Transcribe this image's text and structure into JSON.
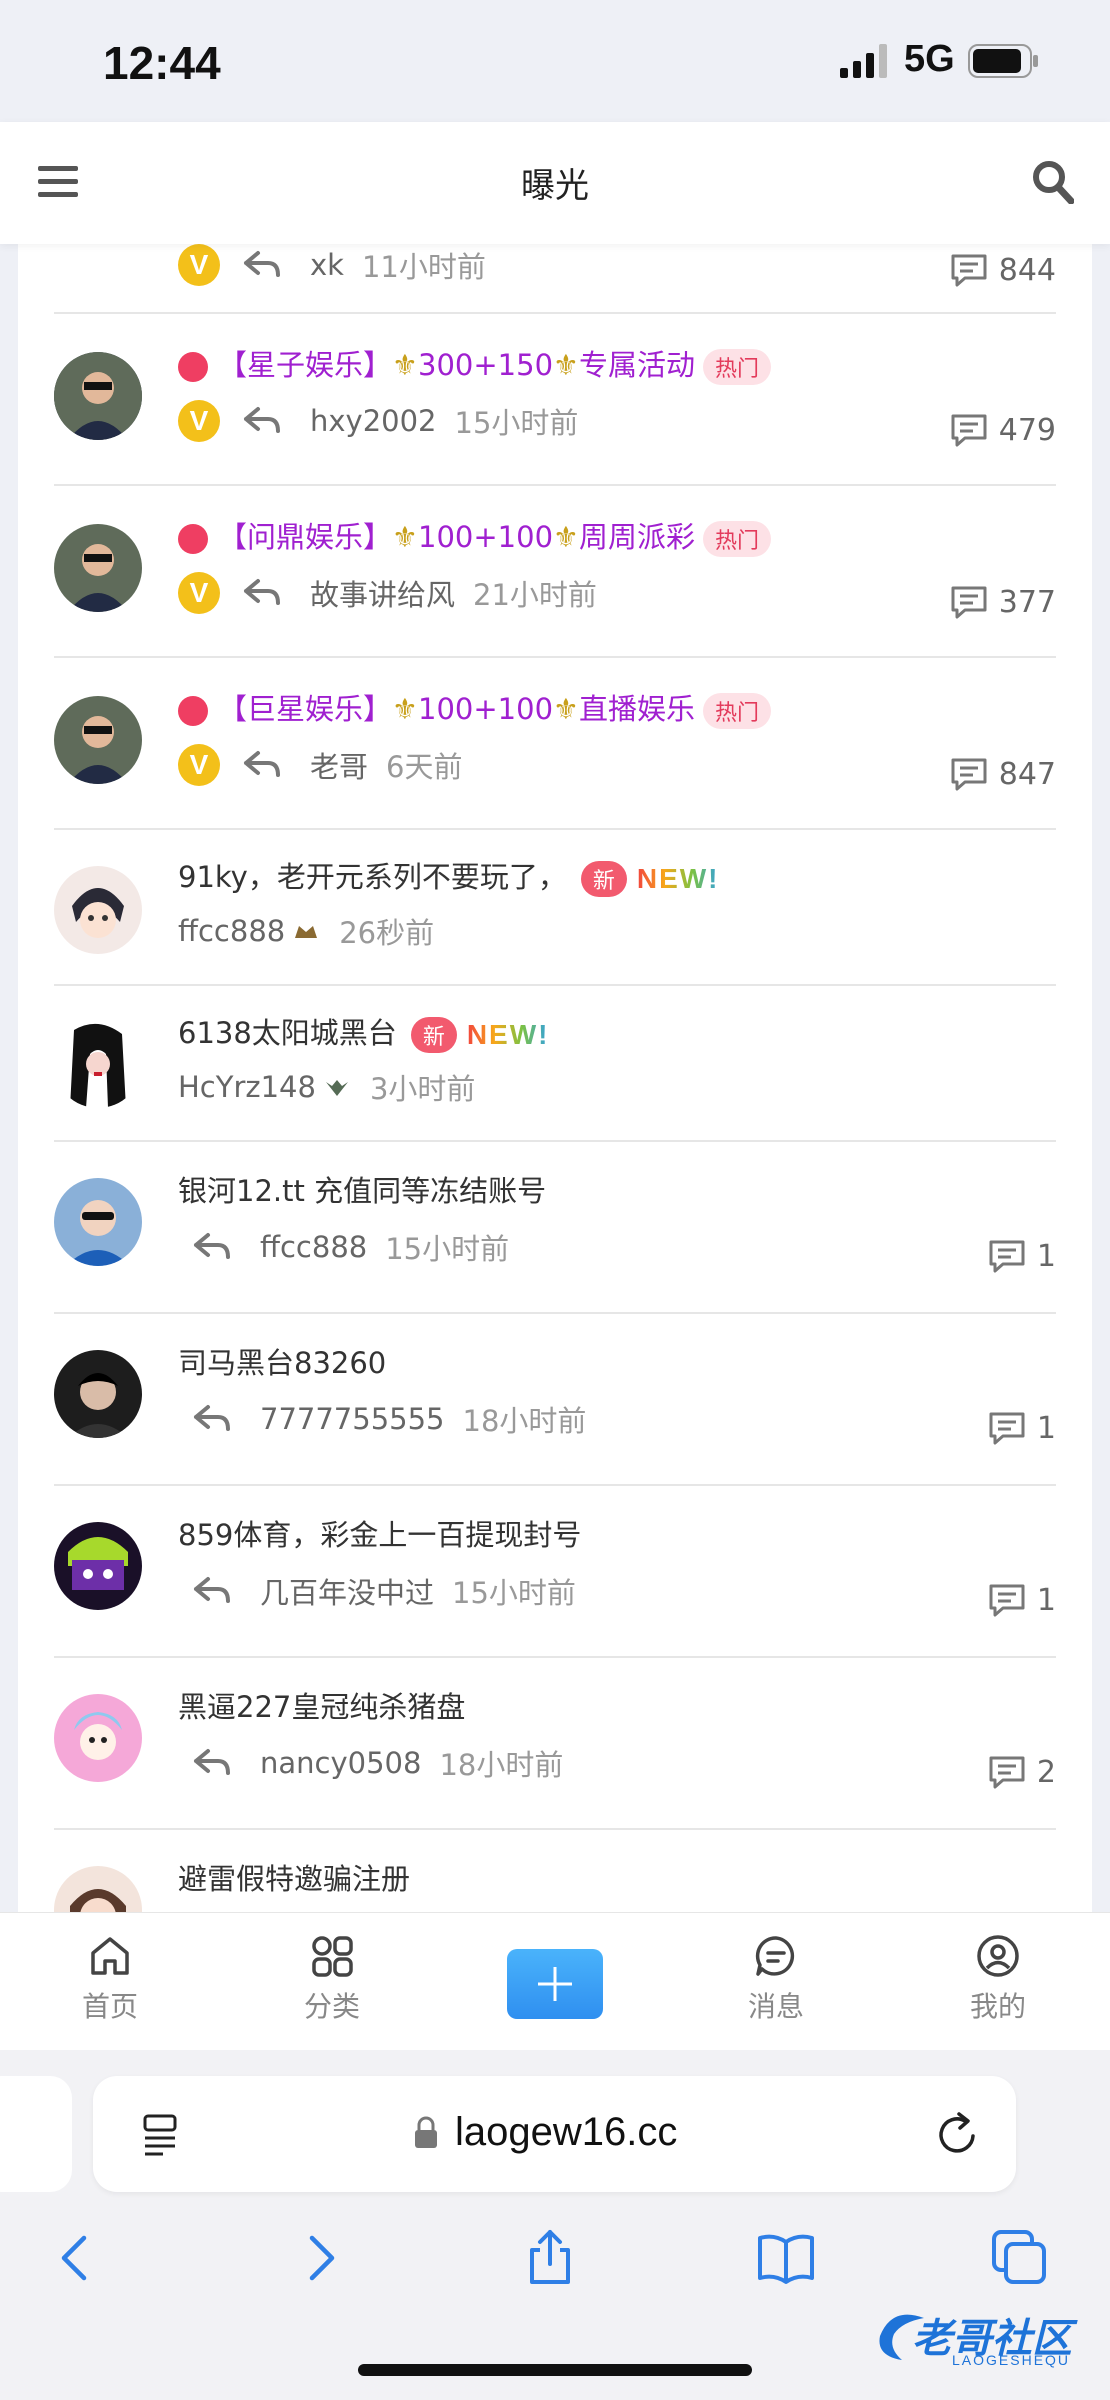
{
  "status_bar": {
    "time": "12:44",
    "network": "5G"
  },
  "header": {
    "title": "曝光"
  },
  "posts": [
    {
      "kind": "pinned",
      "user": "xk",
      "time": "11小时前",
      "comments": "844"
    },
    {
      "kind": "pinned",
      "title": "【星子娱乐】",
      "title_b": "300+150",
      "title_c": "专属活动",
      "badge": "热门",
      "user": "hxy2002",
      "time": "15小时前",
      "comments": "479"
    },
    {
      "kind": "pinned",
      "title": "【问鼎娱乐】",
      "title_b": "100+100",
      "title_c": "周周派彩",
      "badge": "热门",
      "user": "故事讲给风",
      "time": "21小时前",
      "comments": "377"
    },
    {
      "kind": "pinned",
      "title": "【巨星娱乐】",
      "title_b": "100+100",
      "title_c": "直播娱乐",
      "badge": "热门",
      "user": "老哥",
      "time": "6天前",
      "comments": "847"
    },
    {
      "kind": "new",
      "title": "91ky，老开元系列不要玩了，",
      "badge": "新",
      "new_word": "NEW!",
      "user": "ffcc888",
      "time": "26秒前"
    },
    {
      "kind": "new",
      "title": "6138太阳城黑台",
      "badge": "新",
      "new_word": "NEW!",
      "user": "HcYrz148",
      "time": "3小时前"
    },
    {
      "kind": "normal",
      "title": "银河12.tt 充值同等冻结账号",
      "user": "ffcc888",
      "time": "15小时前",
      "comments": "1"
    },
    {
      "kind": "normal",
      "title": "司马黑台83260",
      "user": "7777755555",
      "time": "18小时前",
      "comments": "1"
    },
    {
      "kind": "normal",
      "title": "859体育，彩金上一百提现封号",
      "user": "几百年没中过",
      "time": "15小时前",
      "comments": "1"
    },
    {
      "kind": "normal",
      "title": "黑逼227皇冠纯杀猪盘",
      "user": "nancy0508",
      "time": "18小时前",
      "comments": "2"
    },
    {
      "kind": "normal",
      "title": "避雷假特邀骗注册"
    }
  ],
  "nav": {
    "home": "首页",
    "category": "分类",
    "messages": "消息",
    "mine": "我的"
  },
  "browser": {
    "url": "laogew16.cc"
  },
  "watermark": {
    "text": "老哥社区",
    "sub": "LAOGESHEQU"
  },
  "icons": {
    "menu": "menu-icon",
    "search": "search-icon",
    "reply": "reply-icon",
    "comment": "comment-icon",
    "vip": "vip-badge-icon",
    "home": "home-icon",
    "category": "grid-icon",
    "message": "chat-icon",
    "profile": "user-icon"
  },
  "colors": {
    "accent_blue": "#2f8ff0",
    "hot_purple": "#a020d0",
    "hot_badge": "#e33a5b",
    "vip_gold": "#f3c01a"
  }
}
